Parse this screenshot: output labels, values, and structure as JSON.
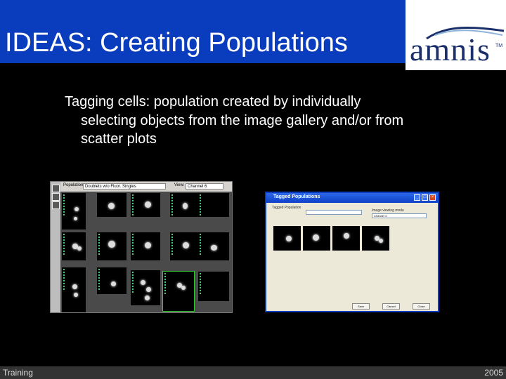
{
  "slide": {
    "title": "IDEAS: Creating Populations",
    "bullet": {
      "line1": "Tagging cells: population created by individually",
      "line2": "selecting objects from the image gallery and/or from",
      "line3": "scatter plots"
    }
  },
  "logo": {
    "text": "amnis",
    "tm": "TM",
    "color": "#1b2f6a"
  },
  "gallery_screenshot": {
    "population_label": "Population:",
    "population_value": "Doublets w/o Fluor. Singles",
    "view_label": "View:",
    "view_value": "Channel 6"
  },
  "dialog_screenshot": {
    "title": "Tagged Populations",
    "group_label": "Tagged Population",
    "image_mode_label": "Image viewing mode",
    "image_mode_value": "Channel 4",
    "buttons": [
      "Save",
      "Cancel",
      "Close"
    ]
  },
  "footer": {
    "left": "Training",
    "right": "2005"
  },
  "colors": {
    "title_bar": "#0a3dbd",
    "background": "#000000",
    "footer": "#333333"
  }
}
